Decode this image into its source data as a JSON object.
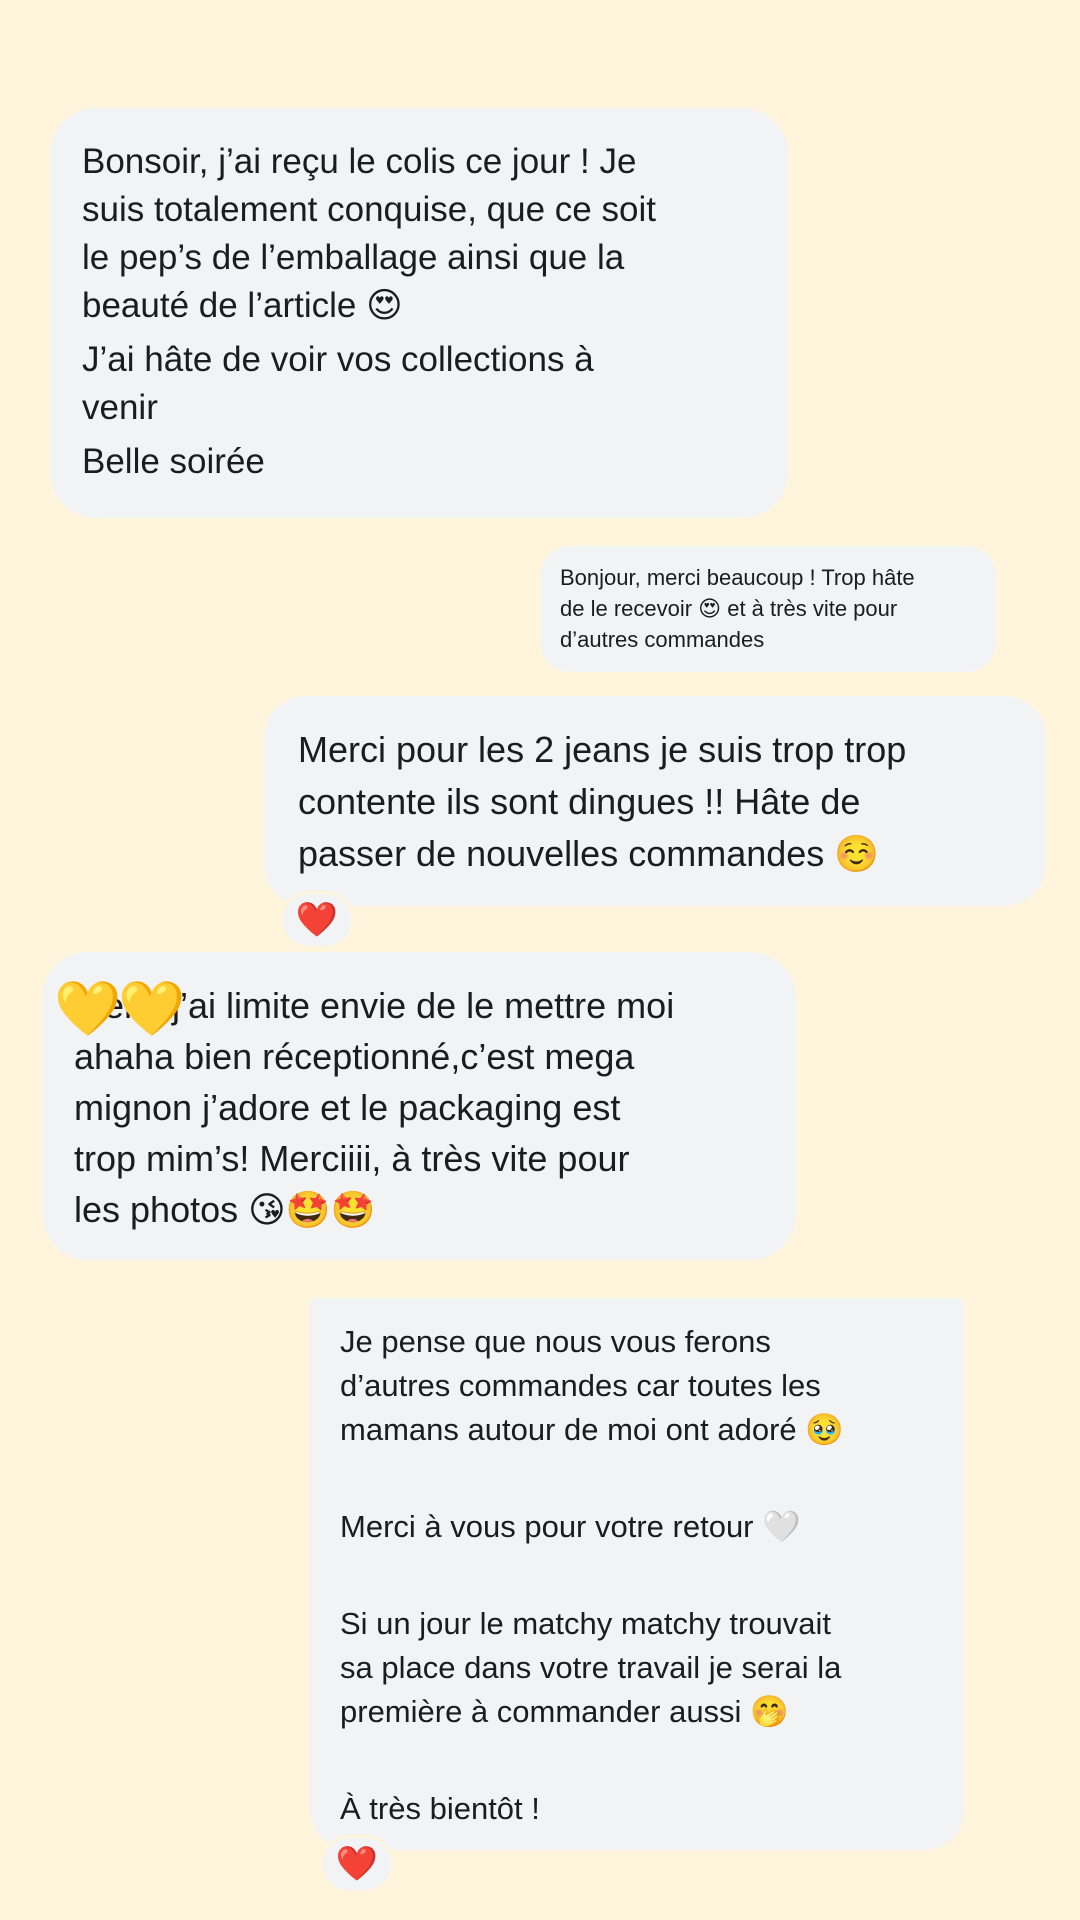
{
  "conversation": {
    "messages": [
      {
        "lines": [
          "Bonsoir, j’ai reçu le colis ce jour ! Je",
          "suis totalement conquise, que ce soit",
          "le pep’s de l’emballage ainsi que la",
          "beauté de l’article 😍",
          "J’ai hâte de voir vos collections à",
          "venir",
          "Belle soirée"
        ]
      },
      {
        "lines": [
          "Bonjour, merci beaucoup ! Trop hâte",
          "de le recevoir 😍 et à très vite pour",
          "d’autres commandes"
        ]
      },
      {
        "lines": [
          "Merci pour les 2 jeans je suis trop trop",
          "contente ils sont dingues !! Hâte de",
          "passer de nouvelles commandes ☺️"
        ],
        "reaction": "❤️"
      },
      {
        "lines": [
          "Merci j’ai limite envie de le mettre moi",
          "ahaha bien réceptionné,c’est mega",
          "mignon j’adore et le packaging est",
          "trop mim’s! Merciiii, à très vite pour",
          "les photos 😘🤩🤩"
        ],
        "overlay_emojis": [
          "💛",
          "💛"
        ]
      },
      {
        "lines": [
          "Je pense que nous vous ferons",
          "d’autres commandes car toutes les",
          "mamans autour de moi ont adoré 🥹",
          "",
          "Merci à vous pour votre retour 🤍",
          "",
          "Si un jour le matchy matchy trouvait",
          "sa place dans votre travail je serai la",
          "première à commander aussi 🤭",
          "",
          "À très bientôt !"
        ],
        "reaction": "❤️"
      }
    ]
  }
}
